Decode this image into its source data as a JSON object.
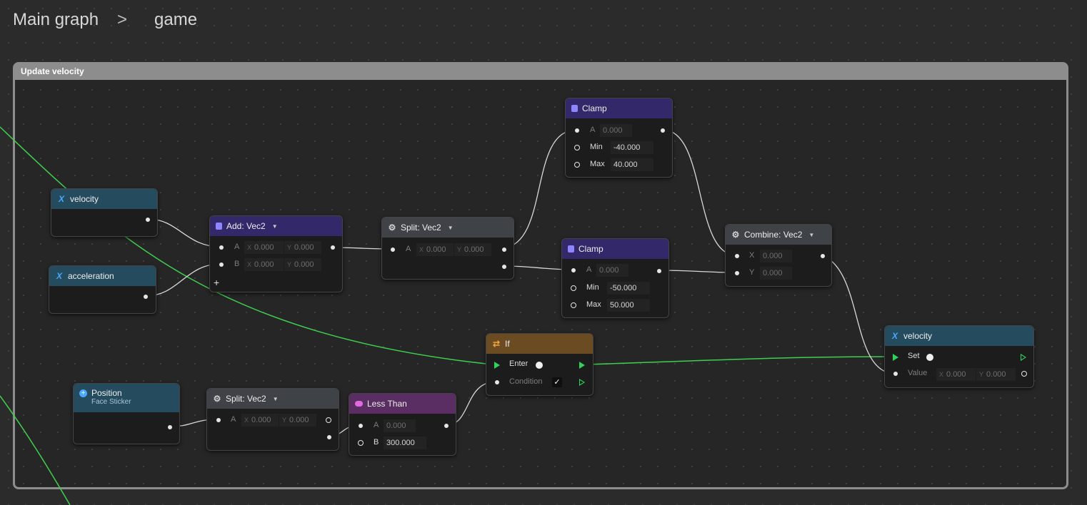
{
  "breadcrumb": {
    "root": "Main graph",
    "separator": ">",
    "current": "game"
  },
  "frame": {
    "title": "Update velocity"
  },
  "nodes": {
    "velocity_get": {
      "title": "velocity"
    },
    "acceleration": {
      "title": "acceleration"
    },
    "add": {
      "title": "Add: Vec2",
      "a_label": "A",
      "b_label": "B",
      "a_x": "0.000",
      "a_y": "0.000",
      "b_x": "0.000",
      "b_y": "0.000",
      "add_pin": "+"
    },
    "split1": {
      "title": "Split: Vec2",
      "a_label": "A",
      "x": "0.000",
      "y": "0.000"
    },
    "clamp_top": {
      "title": "Clamp",
      "a_label": "A",
      "a_value": "0.000",
      "min_label": "Min",
      "min_value": "-40.000",
      "max_label": "Max",
      "max_value": "40.000"
    },
    "clamp_mid": {
      "title": "Clamp",
      "a_label": "A",
      "a_value": "0.000",
      "min_label": "Min",
      "min_value": "-50.000",
      "max_label": "Max",
      "max_value": "50.000"
    },
    "combine": {
      "title": "Combine: Vec2",
      "x_label": "X",
      "x_value": "0.000",
      "y_label": "Y",
      "y_value": "0.000"
    },
    "velocity_set": {
      "title": "velocity",
      "set_label": "Set",
      "value_label": "Value",
      "x": "0.000",
      "y": "0.000"
    },
    "if_node": {
      "title": "If",
      "enter_label": "Enter",
      "condition_label": "Condition",
      "checkmark": "✓"
    },
    "position": {
      "title": "Position",
      "subtitle": "Face Sticker"
    },
    "split2": {
      "title": "Split: Vec2",
      "a_label": "A",
      "x": "0.000",
      "y": "0.000"
    },
    "less_than": {
      "title": "Less Than",
      "a_label": "A",
      "a_value": "0.000",
      "b_label": "B",
      "b_value": "300.000"
    }
  },
  "axis_labels": {
    "x": "X",
    "y": "Y"
  },
  "icons": {
    "variable": "variable-x-icon",
    "math": "calculator-icon",
    "gear": "gear-icon",
    "if": "branch-icon",
    "compare": "compare-icon",
    "position": "plus-circle-icon"
  },
  "colors": {
    "exec_wire": "#3fcf4f",
    "data_wire": "#e6e6e6",
    "frame": "#8d8d8d"
  }
}
